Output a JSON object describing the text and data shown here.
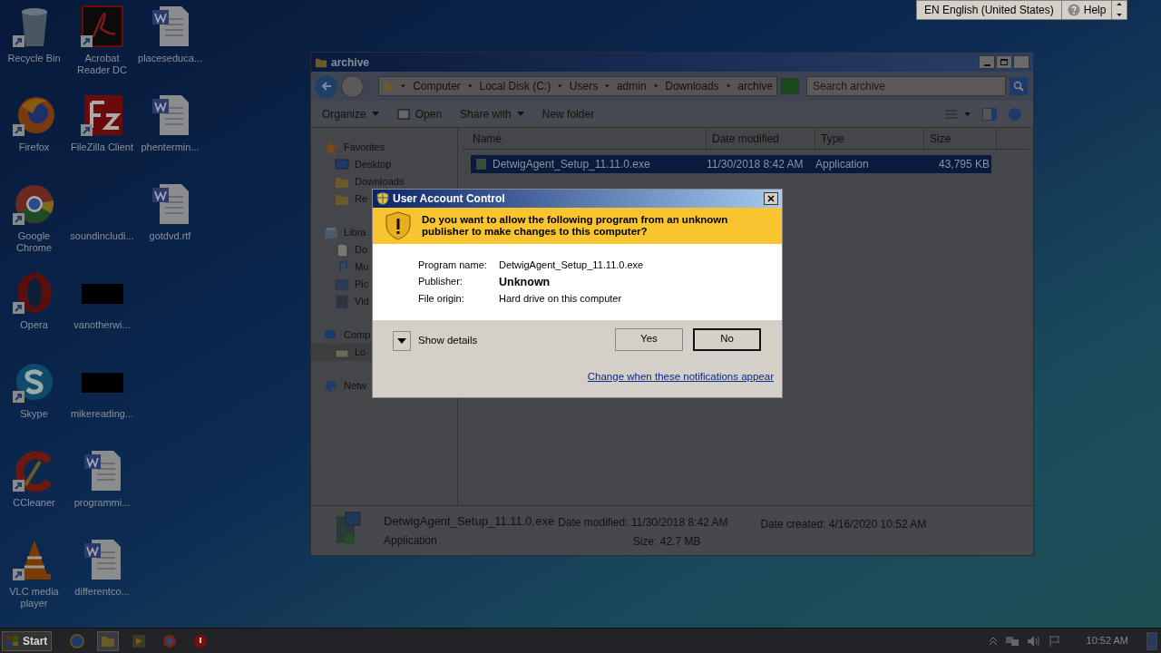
{
  "language_bar": {
    "language": "EN English (United States)",
    "help": "Help"
  },
  "desktop_columns": [
    [
      {
        "label": "Recycle Bin",
        "kind": "recycle"
      },
      {
        "label": "Firefox",
        "kind": "firefox"
      },
      {
        "label": "Google Chrome",
        "kind": "chrome"
      },
      {
        "label": "Opera",
        "kind": "opera"
      },
      {
        "label": "Skype",
        "kind": "skype"
      },
      {
        "label": "CCleaner",
        "kind": "ccleaner"
      },
      {
        "label": "VLC media player",
        "kind": "vlc"
      }
    ],
    [
      {
        "label": "Acrobat Reader DC",
        "kind": "acrobat"
      },
      {
        "label": "FileZilla Client",
        "kind": "filezilla"
      },
      {
        "label": "soundincludi...",
        "kind": "blank"
      },
      {
        "label": "vanotherwi...",
        "kind": "black"
      },
      {
        "label": "mikereading...",
        "kind": "black"
      },
      {
        "label": "programmi...",
        "kind": "doc"
      },
      {
        "label": "differentco...",
        "kind": "doc"
      }
    ],
    [
      {
        "label": "placeseduca...",
        "kind": "doc"
      },
      {
        "label": "phentermin...",
        "kind": "doc"
      },
      {
        "label": "gotdvd.rtf",
        "kind": "doc"
      }
    ]
  ],
  "explorer": {
    "title": "archive",
    "breadcrumb": [
      "Computer",
      "Local Disk (C:)",
      "Users",
      "admin",
      "Downloads",
      "archive"
    ],
    "search": {
      "placeholder": "Search archive"
    },
    "toolbar": [
      {
        "label": "Organize",
        "kind": "menu"
      },
      {
        "label": "Open",
        "kind": "icon"
      },
      {
        "label": "Share with",
        "kind": "menu"
      },
      {
        "label": "New folder",
        "kind": "plain"
      }
    ],
    "sidebar": [
      {
        "label": "Favorites",
        "kind": "star",
        "selected": false,
        "children": [
          {
            "label": "Desktop",
            "kind": "desktop",
            "selected": false
          },
          {
            "label": "Downloads",
            "kind": "folder",
            "selected": false
          },
          {
            "label": "Re",
            "kind": "folder",
            "selected": false
          }
        ]
      },
      {
        "label": "Libra",
        "kind": "library",
        "selected": false,
        "children": [
          {
            "label": "Do",
            "kind": "doc",
            "selected": false
          },
          {
            "label": "Mu",
            "kind": "music",
            "selected": false
          },
          {
            "label": "Pic",
            "kind": "pictures",
            "selected": false
          },
          {
            "label": "Vid",
            "kind": "video",
            "selected": false
          }
        ]
      },
      {
        "label": "Comp",
        "kind": "computer",
        "selected": false,
        "children": [
          {
            "label": "Lo",
            "kind": "disk",
            "selected": true
          }
        ]
      },
      {
        "label": "Netw",
        "kind": "network",
        "selected": false
      }
    ],
    "columns": [
      "Name",
      "Date modified",
      "Type",
      "Size"
    ],
    "rows": [
      {
        "name": "DetwigAgent_Setup_11.11.0.exe",
        "date": "11/30/2018 8:42 AM",
        "type": "Application",
        "size": "43,795 KB",
        "selected": true
      }
    ],
    "details": {
      "name": "DetwigAgent_Setup_11.11.0.exe",
      "type": "Application",
      "modified_label": "Date modified:",
      "modified": "11/30/2018 8:42 AM",
      "created_label": "Date created:",
      "created": "4/16/2020 10:52 AM",
      "size_label": "Size:",
      "size": "42.7 MB"
    }
  },
  "uac": {
    "title": "User Account Control",
    "question": "Do you want to allow the following program from an unknown publisher to make changes to this computer?",
    "fields": [
      {
        "label": "Program name:",
        "value": "DetwigAgent_Setup_11.11.0.exe",
        "emphasis": false
      },
      {
        "label": "Publisher:",
        "value": "Unknown",
        "emphasis": true
      },
      {
        "label": "File origin:",
        "value": "Hard drive on this computer",
        "emphasis": false
      }
    ],
    "show_details": "Show details",
    "buttons": [
      {
        "label": "Yes",
        "default": false
      },
      {
        "label": "No",
        "default": true
      }
    ],
    "link": "Change when these notifications appear"
  },
  "taskbar": {
    "start": "Start",
    "apps": [
      {
        "kind": "ie",
        "selected": false
      },
      {
        "kind": "explorer",
        "selected": true
      },
      {
        "kind": "media",
        "selected": false
      },
      {
        "kind": "chrome",
        "selected": false
      },
      {
        "kind": "opera",
        "selected": false
      }
    ],
    "clock": "10:52 AM"
  }
}
